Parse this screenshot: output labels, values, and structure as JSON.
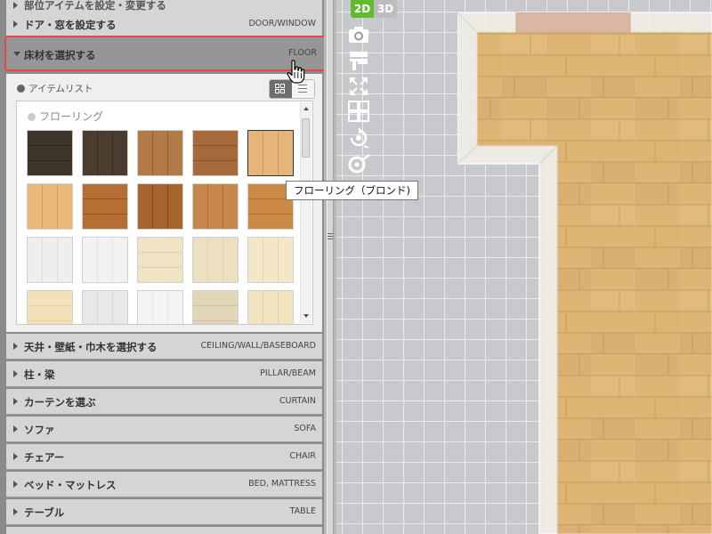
{
  "accordion": {
    "top_partial": {
      "jp": "部位アイテムを設定・変更する",
      "en": ""
    },
    "door": {
      "jp": "ドア・窓を設定する",
      "en": "DOOR/WINDOW"
    },
    "floor": {
      "jp": "床材を選択する",
      "en": "FLOOR"
    },
    "ceiling": {
      "jp": "天井・壁紙・巾木を選択する",
      "en": "CEILING/WALL/BASEBOARD"
    },
    "pillar": {
      "jp": "柱・梁",
      "en": "PILLAR/BEAM"
    },
    "curtain": {
      "jp": "カーテンを選ぶ",
      "en": "CURTAIN"
    },
    "sofa": {
      "jp": "ソファ",
      "en": "SOFA"
    },
    "chair": {
      "jp": "チェアー",
      "en": "CHAIR"
    },
    "bed": {
      "jp": "ベッド・マットレス",
      "en": "BED, MATTRESS"
    },
    "table": {
      "jp": "テーブル",
      "en": "TABLE"
    }
  },
  "floor_panel": {
    "item_list_label": "アイテムリスト",
    "category_label": "フローリング",
    "view_mode": "grid",
    "tiles": [
      {
        "name": "tile-dark-1",
        "color": "#3d342a",
        "stripe": "#2a231b"
      },
      {
        "name": "tile-dark-2",
        "color": "#4a3d30",
        "stripe": "#332a20"
      },
      {
        "name": "tile-brown-1",
        "color": "#b27a46",
        "stripe": "#8e5e33"
      },
      {
        "name": "tile-brown-2",
        "color": "#a76b3b",
        "stripe": "#7d4f2a"
      },
      {
        "name": "tile-blonde",
        "color": "#e6b57a",
        "stripe": "#cf9d63",
        "selected": true
      },
      {
        "name": "tile-light-oak",
        "color": "#e8b978",
        "stripe": "#d49f5e"
      },
      {
        "name": "tile-teak",
        "color": "#b56f33",
        "stripe": "#945626"
      },
      {
        "name": "tile-walnut",
        "color": "#a9642d",
        "stripe": "#85491f"
      },
      {
        "name": "tile-cherry",
        "color": "#c8874a",
        "stripe": "#a96c36"
      },
      {
        "name": "tile-maple",
        "color": "#cc8a46",
        "stripe": "#ad6f32"
      },
      {
        "name": "tile-white-1",
        "color": "#eeeeee",
        "stripe": "#dddddd"
      },
      {
        "name": "tile-white-2",
        "color": "#f2f2f2",
        "stripe": "#e2e2e2"
      },
      {
        "name": "tile-cream-1",
        "color": "#efe3c4",
        "stripe": "#e0d0aa"
      },
      {
        "name": "tile-cream-2",
        "color": "#ece0c0",
        "stripe": "#ddd0a8"
      },
      {
        "name": "tile-cream-3",
        "color": "#f3e7c8",
        "stripe": "#e3d5b0"
      },
      {
        "name": "tile-pale-1",
        "color": "#f3e2b9",
        "stripe": "#e4d09f"
      },
      {
        "name": "tile-pale-2",
        "color": "#e8e8e8",
        "stripe": "#d6d6d6"
      },
      {
        "name": "tile-pale-3",
        "color": "#f4f4f4",
        "stripe": "#e6e6e6"
      },
      {
        "name": "tile-pale-4",
        "color": "#e2d6b8",
        "stripe": "#d0c29e"
      },
      {
        "name": "tile-pale-5",
        "color": "#f2e3bf",
        "stripe": "#e2d0a6"
      }
    ]
  },
  "toolbar": {
    "btn_2d": "2D",
    "btn_3d": "3D",
    "active": "2D"
  },
  "tooltip": {
    "text": "フローリング（ブロンド)"
  },
  "colors": {
    "highlight": "#e4464a",
    "active_2d": "#63ba2c",
    "floor_wood": "#ddb575"
  }
}
